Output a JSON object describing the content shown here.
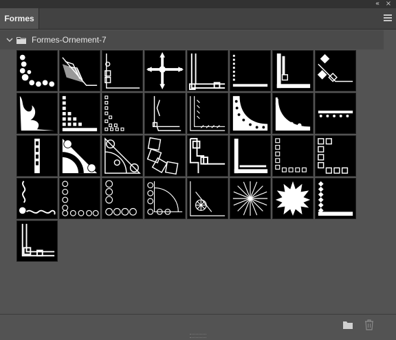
{
  "panel": {
    "collapse_glyph": "«",
    "close_glyph": "×",
    "tab_label": "Formes",
    "menu_icon": "hamburger-icon"
  },
  "group": {
    "name": "Formes-Ornement-7",
    "expanded": true,
    "icon": "folder-icon"
  },
  "shapes_count": 33,
  "footer": {
    "new_group_icon": "folder-icon",
    "delete_icon": "trash-icon"
  }
}
